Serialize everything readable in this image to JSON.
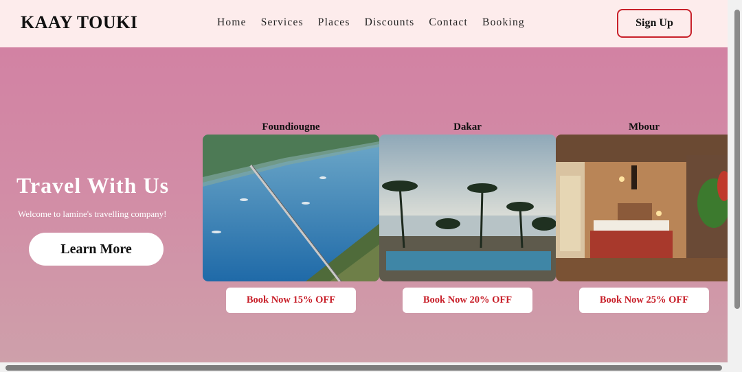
{
  "header": {
    "logo": "KAAY TOUKI",
    "nav": [
      "Home",
      "Services",
      "Places",
      "Discounts",
      "Contact",
      "Booking"
    ],
    "signup_label": "Sign Up"
  },
  "hero": {
    "title": "Travel With Us",
    "subtitle": "Welcome to lamine's travelling company!",
    "cta_label": "Learn More"
  },
  "places": [
    {
      "name": "Foundiougne",
      "book_label": "Book Now 15% OFF"
    },
    {
      "name": "Dakar",
      "book_label": "Book Now 20% OFF"
    },
    {
      "name": "Mbour",
      "book_label": "Book Now 25% OFF"
    }
  ],
  "colors": {
    "header_bg": "#fdecec",
    "hero_top": "#d282a3",
    "hero_bottom": "#cea0aa",
    "accent_red": "#c8202a"
  }
}
